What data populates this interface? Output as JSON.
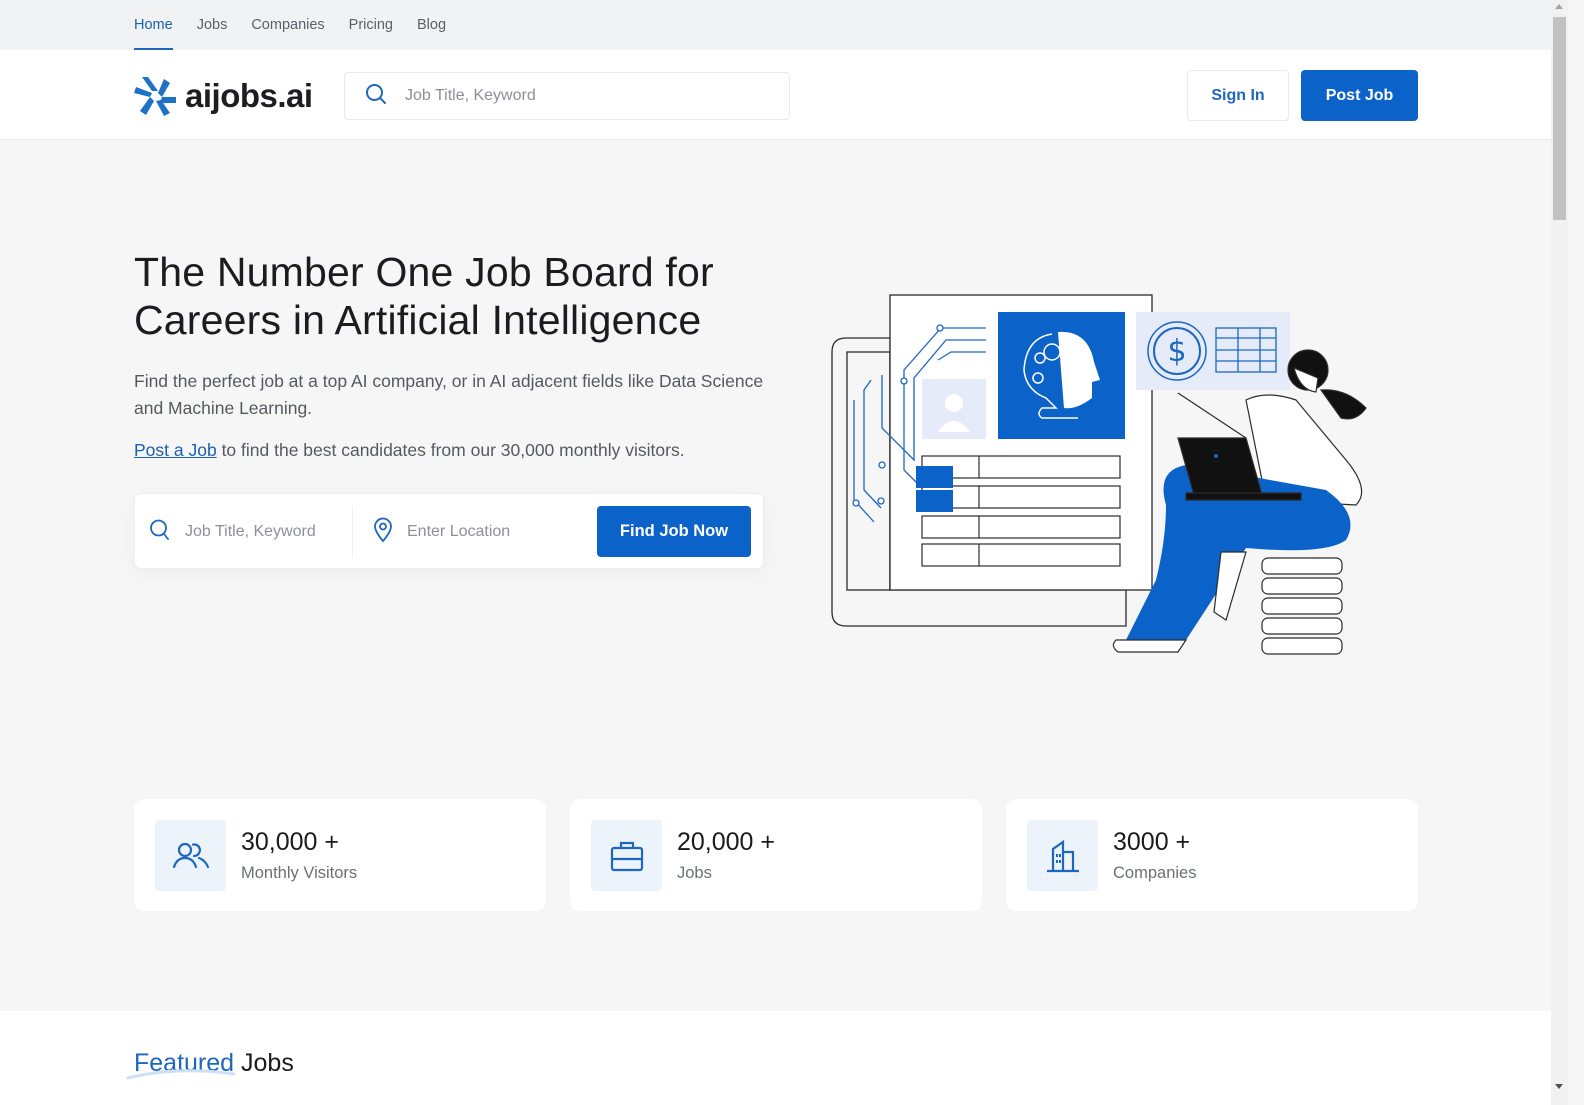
{
  "topnav": {
    "items": [
      {
        "label": "Home",
        "active": true
      },
      {
        "label": "Jobs",
        "active": false
      },
      {
        "label": "Companies",
        "active": false
      },
      {
        "label": "Pricing",
        "active": false
      },
      {
        "label": "Blog",
        "active": false
      }
    ]
  },
  "header": {
    "logo_text": "aijobs.ai",
    "search_placeholder": "Job Title, Keyword",
    "signin_label": "Sign In",
    "postjob_label": "Post Job"
  },
  "hero": {
    "title": "The Number One Job Board for Careers in Artificial Intelligence",
    "description": "Find the perfect job at a top AI company, or in AI adjacent fields like Data Science and Machine Learning.",
    "cta_link": "Post a Job",
    "cta_rest": " to find the best candidates from our 30,000 monthly visitors.",
    "search": {
      "keyword_placeholder": "Job Title, Keyword",
      "location_placeholder": "Enter Location",
      "button_label": "Find Job Now"
    }
  },
  "stats": [
    {
      "icon": "users-icon",
      "value": "30,000 +",
      "label": "Monthly Visitors"
    },
    {
      "icon": "briefcase-icon",
      "value": "20,000 +",
      "label": "Jobs"
    },
    {
      "icon": "building-icon",
      "value": "3000 +",
      "label": "Companies"
    }
  ],
  "featured": {
    "accent": "Featured",
    "rest": " Jobs"
  },
  "colors": {
    "primary": "#0b63c9",
    "accent_text": "#1d67c0",
    "page_bg": "#f6f6f7",
    "nav_bg": "#f1f2f4",
    "icon_box_bg": "#edf3fb"
  }
}
